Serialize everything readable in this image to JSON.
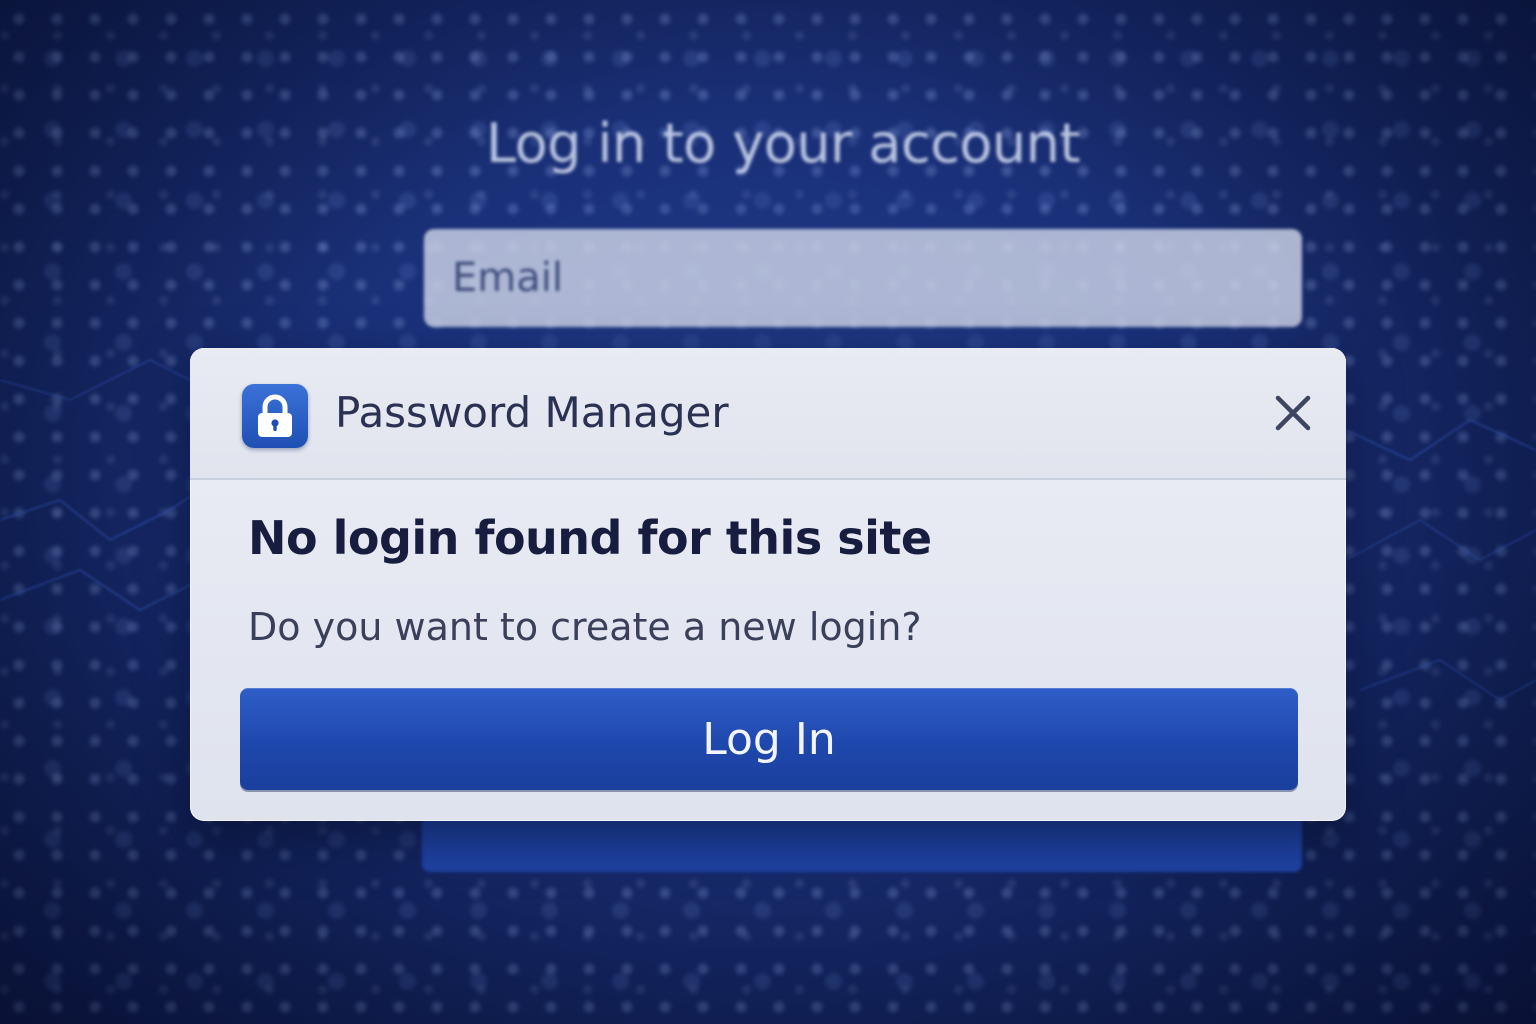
{
  "login_page": {
    "title": "Log in to your account",
    "email_placeholder": "Email"
  },
  "popup": {
    "app_icon": "lock-icon",
    "app_name": "Password Manager",
    "close_icon": "close-icon",
    "title": "No login found for this site",
    "message": "Do you want to create a new login?",
    "primary_button_label": "Log In"
  },
  "colors": {
    "background": "#1d3580",
    "accent": "#1f48ad",
    "popup_surface": "#e6e9f2",
    "title_text": "#161d3e"
  }
}
